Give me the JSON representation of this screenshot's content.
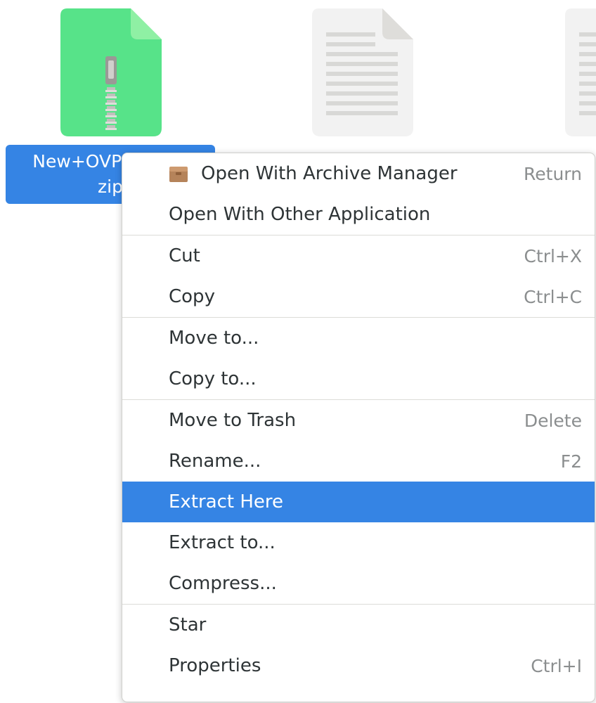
{
  "desktop": {
    "files": [
      {
        "label_line1": "New+OVPN+Files",
        "label_line2": "zip",
        "icon": "zip-archive-file-icon",
        "selected": true,
        "icon_color": "#57e389"
      },
      {
        "label": "",
        "icon": "text-document-icon",
        "selected": false
      },
      {
        "label": "",
        "icon": "text-document-icon",
        "selected": false
      }
    ]
  },
  "context_menu": {
    "sections": [
      {
        "items": [
          {
            "label": "Open With Archive Manager",
            "shortcut": "Return",
            "icon": "archive-manager-icon"
          },
          {
            "label": "Open With Other Application",
            "shortcut": ""
          }
        ]
      },
      {
        "items": [
          {
            "label": "Cut",
            "shortcut": "Ctrl+X"
          },
          {
            "label": "Copy",
            "shortcut": "Ctrl+C"
          }
        ]
      },
      {
        "items": [
          {
            "label": "Move to...",
            "shortcut": ""
          },
          {
            "label": "Copy to...",
            "shortcut": ""
          }
        ]
      },
      {
        "items": [
          {
            "label": "Move to Trash",
            "shortcut": "Delete"
          },
          {
            "label": "Rename...",
            "shortcut": "F2"
          },
          {
            "label": "Extract Here",
            "shortcut": "",
            "highlighted": true
          },
          {
            "label": "Extract to...",
            "shortcut": ""
          },
          {
            "label": "Compress...",
            "shortcut": ""
          }
        ]
      },
      {
        "items": [
          {
            "label": "Star",
            "shortcut": ""
          },
          {
            "label": "Properties",
            "shortcut": "Ctrl+I"
          }
        ]
      }
    ]
  },
  "colors": {
    "selection": "#3584e4",
    "zip_icon": "#57e389",
    "document_icon": "#f2f2f2"
  }
}
